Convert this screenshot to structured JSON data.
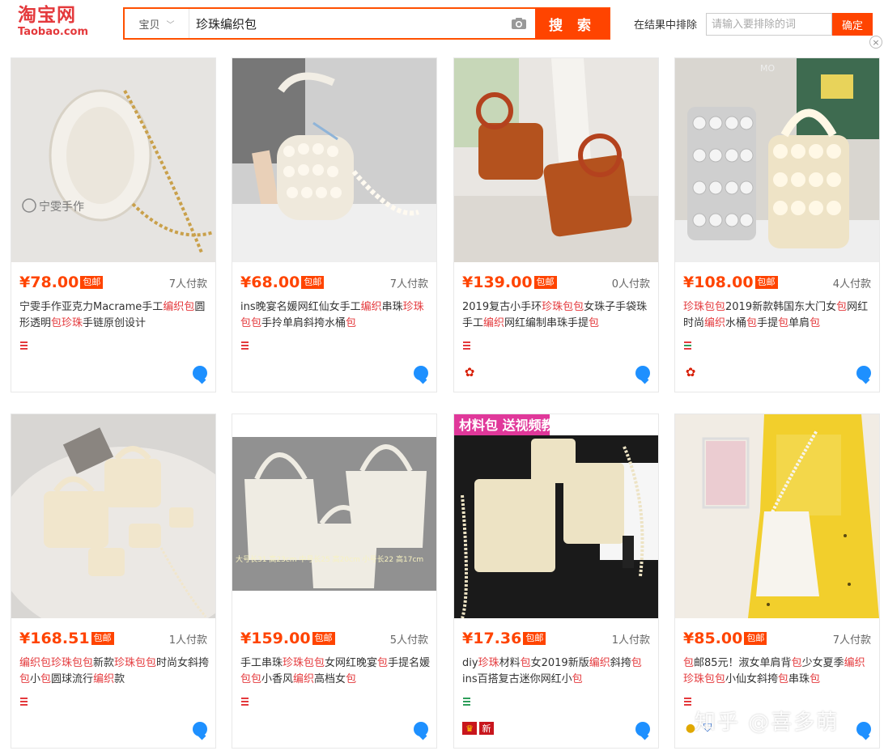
{
  "header": {
    "logo_cn": "淘宝网",
    "logo_en": "Taobao.com",
    "search_category": "宝贝",
    "search_query": "珍珠编织包",
    "search_button": "搜 索",
    "exclude_label": "在结果中排除",
    "exclude_placeholder": "请输入要排除的词",
    "exclude_button": "确定"
  },
  "colors": {
    "accent": "#ff4400",
    "keyword": "#e4393c"
  },
  "products": [
    {
      "price": "¥78.00",
      "shipping": "包邮",
      "sold": "7人付款",
      "title": [
        [
          "宁雯手作亚克力Macrame手工",
          0
        ],
        [
          "编织包",
          1
        ],
        [
          "圆形透明",
          0
        ],
        [
          "包珍珠",
          1
        ],
        [
          "手链原创设计",
          0
        ]
      ],
      "pic_text": "宁雯手作"
    },
    {
      "price": "¥68.00",
      "shipping": "包邮",
      "sold": "7人付款",
      "title": [
        [
          "ins晚宴名媛网红仙女手工",
          0
        ],
        [
          "编织",
          1
        ],
        [
          "串珠",
          0
        ],
        [
          "珍珠包包",
          1
        ],
        [
          "手拎单肩斜挎水桶",
          0
        ],
        [
          "包",
          1
        ]
      ],
      "pic_text": ""
    },
    {
      "price": "¥139.00",
      "shipping": "包邮",
      "sold": "0人付款",
      "title": [
        [
          "2019复古小手环",
          0
        ],
        [
          "珍珠包包",
          1
        ],
        [
          "女珠子手袋珠手工",
          0
        ],
        [
          "编织",
          1
        ],
        [
          "网红编制串珠手提",
          0
        ],
        [
          "包",
          1
        ]
      ],
      "pic_text": ""
    },
    {
      "price": "¥108.00",
      "shipping": "包邮",
      "sold": "4人付款",
      "title": [
        [
          "珍珠包包",
          1
        ],
        [
          "2019新款韩国东大门女",
          0
        ],
        [
          "包",
          1
        ],
        [
          "网红时尚",
          0
        ],
        [
          "编织",
          1
        ],
        [
          "水桶",
          0
        ],
        [
          "包",
          1
        ],
        [
          "手提",
          0
        ],
        [
          "包",
          1
        ],
        [
          "单肩",
          0
        ],
        [
          "包",
          1
        ]
      ],
      "pic_text": "MO"
    },
    {
      "price": "¥168.51",
      "shipping": "包邮",
      "sold": "1人付款",
      "title": [
        [
          "编织包珍珠包包",
          1
        ],
        [
          "新款",
          0
        ],
        [
          "珍珠包包",
          1
        ],
        [
          "时尚女斜挎",
          0
        ],
        [
          "包",
          1
        ],
        [
          "小",
          0
        ],
        [
          "包",
          1
        ],
        [
          "圆球流行",
          0
        ],
        [
          "编织",
          1
        ],
        [
          "款",
          0
        ]
      ],
      "pic_text": ""
    },
    {
      "price": "¥159.00",
      "shipping": "包邮",
      "sold": "5人付款",
      "title": [
        [
          "手工串珠",
          0
        ],
        [
          "珍珠包包",
          1
        ],
        [
          "女网红晚宴",
          0
        ],
        [
          "包",
          1
        ],
        [
          "手提名媛",
          0
        ],
        [
          "包包",
          1
        ],
        [
          "小香风",
          0
        ],
        [
          "编织",
          1
        ],
        [
          "高档女",
          0
        ],
        [
          "包",
          1
        ]
      ],
      "pic_text": "大号长31 高23cm 中号长25 高20cm 小号长22 高17cm"
    },
    {
      "price": "¥17.36",
      "shipping": "包邮",
      "sold": "1人付款",
      "title": [
        [
          "diy",
          0
        ],
        [
          "珍珠",
          1
        ],
        [
          "材料",
          0
        ],
        [
          "包",
          1
        ],
        [
          "女2019新版",
          0
        ],
        [
          "编织",
          1
        ],
        [
          "斜挎",
          0
        ],
        [
          "包",
          1
        ],
        [
          "ins百搭复古迷你网红小",
          0
        ],
        [
          "包",
          1
        ]
      ],
      "pic_text": "材料包 送视频教程",
      "badge_new": "新"
    },
    {
      "price": "¥85.00",
      "shipping": "包邮",
      "sold": "7人付款",
      "title": [
        [
          "包",
          1
        ],
        [
          "邮85元！淑女单肩背",
          0
        ],
        [
          "包",
          1
        ],
        [
          "少女夏季",
          0
        ],
        [
          "编织珍珠包包",
          1
        ],
        [
          "小仙女斜挎",
          0
        ],
        [
          "包",
          1
        ],
        [
          "串珠",
          0
        ],
        [
          "包",
          1
        ]
      ],
      "pic_text": ""
    }
  ],
  "watermark": "知乎 @喜多萌"
}
